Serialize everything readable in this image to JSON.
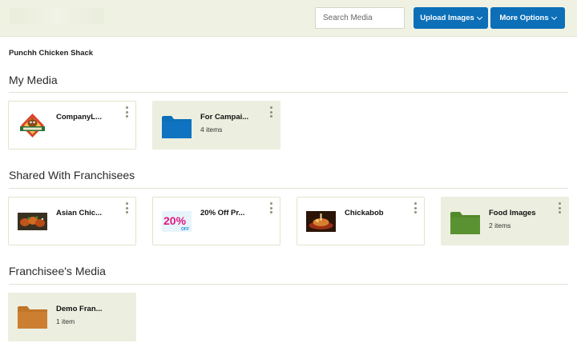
{
  "header": {
    "search_placeholder": "Search Media",
    "upload_label": "Upload Images",
    "more_label": "More Options"
  },
  "company_name": "Punchh Chicken Shack",
  "sections": [
    {
      "title": "My Media",
      "items": [
        {
          "name": "CompanyL...",
          "kind": "image",
          "icon": "company-logo-thumb"
        },
        {
          "name": "For Campai...",
          "kind": "folder",
          "count": "4 items",
          "folder_color": "#0d6fb8"
        }
      ]
    },
    {
      "title": "Shared With Franchisees",
      "items": [
        {
          "name": "Asian Chic...",
          "kind": "image",
          "icon": "asian-chicken-thumb"
        },
        {
          "name": "20% Off Pr...",
          "kind": "image",
          "icon": "twenty-percent-off-thumb",
          "thumb_text": "20%",
          "thumb_subtext": "OFF"
        },
        {
          "name": "Chickabob",
          "kind": "image",
          "icon": "chickabob-thumb"
        },
        {
          "name": "Food Images",
          "kind": "folder",
          "count": "2 items",
          "folder_color": "#5a9231"
        }
      ]
    },
    {
      "title": "Franchisee's Media",
      "items": [
        {
          "name": "Demo Fran...",
          "kind": "folder",
          "count": "1 item",
          "folder_color": "#cc7f31"
        }
      ]
    }
  ],
  "colors": {
    "primary_button": "#0c6fb8",
    "header_bg": "#eff2e2",
    "folder_card_bg": "#eceedf"
  }
}
